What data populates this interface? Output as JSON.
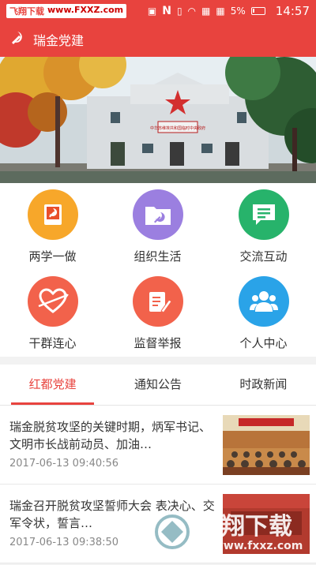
{
  "statusbar": {
    "watermark_brand": "飞翔下载",
    "watermark_site": "www.FXXZ.com",
    "signal_text": "N",
    "battery": "5%",
    "time": "14:57"
  },
  "appbar": {
    "title": "瑞金党建"
  },
  "banner": {
    "sign_text": "中华苏维埃共和国临时中央政府"
  },
  "grid": [
    {
      "label": "两学一做",
      "icon": "party-book-icon",
      "color": "#f7a72a"
    },
    {
      "label": "组织生活",
      "icon": "party-folder-icon",
      "color": "#9b7fe0"
    },
    {
      "label": "交流互动",
      "icon": "chat-icon",
      "color": "#27b36b"
    },
    {
      "label": "干群连心",
      "icon": "heart-icon",
      "color": "#f2624b"
    },
    {
      "label": "监督举报",
      "icon": "report-icon",
      "color": "#f2624b"
    },
    {
      "label": "个人中心",
      "icon": "people-icon",
      "color": "#2aa3e8"
    }
  ],
  "tabs": [
    {
      "label": "红都党建",
      "active": true
    },
    {
      "label": "通知公告",
      "active": false
    },
    {
      "label": "时政新闻",
      "active": false
    }
  ],
  "news": [
    {
      "headline": "瑞金脱贫攻坚的关键时期，炳军书记、文明市长战前动员、加油…",
      "date": "2017-06-13 09:40:56"
    },
    {
      "headline": "瑞金召开脱贫攻坚誓师大会 表决心、交军令状，誓言…",
      "date": "2017-06-13 09:38:50"
    }
  ],
  "watermark": {
    "brand": "飞翔下载",
    "site": "www.fxxz.com"
  }
}
